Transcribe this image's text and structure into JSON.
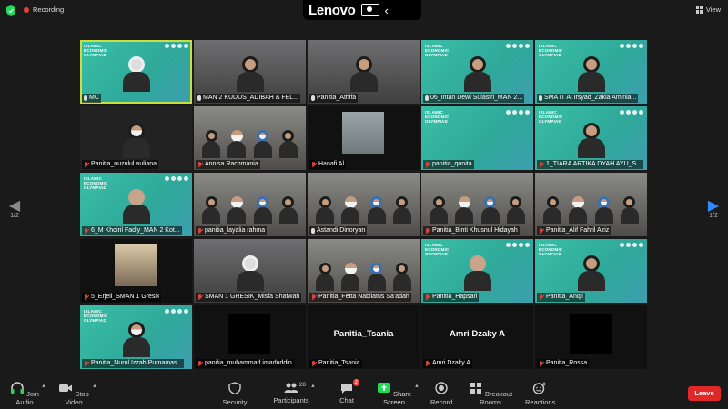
{
  "top": {
    "recording": "Recording",
    "brand": "Lenovo",
    "view": "View"
  },
  "pager": {
    "left": "1/2",
    "right": "1/2"
  },
  "tiles": [
    {
      "name": "MC",
      "muted": false,
      "style": "green-mc",
      "banner": "ISLAMIC\nECONOMIC\nOLYMPIAD"
    },
    {
      "name": "MAN 2 KUDUS_ADIBAH & FEL...",
      "muted": false,
      "style": "room-two"
    },
    {
      "name": "Panitia_Athifa",
      "muted": false,
      "style": "room-two"
    },
    {
      "name": "06_Intan Dewi Sulastri_MAN 2...",
      "muted": false,
      "style": "green-hijab"
    },
    {
      "name": "SMA IT Al Irsyad_Zakia Aminia...",
      "muted": false,
      "style": "green-hijab"
    },
    {
      "name": "Panitia_nuzulul auliana",
      "muted": true,
      "style": "dark-mask"
    },
    {
      "name": "Annisa Rachmania",
      "muted": true,
      "style": "class-crowd"
    },
    {
      "name": "Hanafi Al",
      "muted": true,
      "style": "photo"
    },
    {
      "name": "panitia_qonita",
      "muted": true,
      "style": "green-empty"
    },
    {
      "name": "1_TIARA ARTIKA DYAH AYU_S...",
      "muted": true,
      "style": "green-hijab"
    },
    {
      "name": "6_M Khoiril Fadly_MAN 2 Kot...",
      "muted": true,
      "style": "green-person"
    },
    {
      "name": "panitia_layalia rahma",
      "muted": true,
      "style": "class-crowd"
    },
    {
      "name": "Astandi Dinoryan",
      "muted": false,
      "style": "class-crowd"
    },
    {
      "name": "Panitia_Binti Khusnul Hidayah",
      "muted": true,
      "style": "class-crowd"
    },
    {
      "name": "Panitia_Alif Fahril Aziz",
      "muted": true,
      "style": "class-crowd"
    },
    {
      "name": "5_Erjeli_SMAN 1 Gresik",
      "muted": true,
      "style": "photo-hijab"
    },
    {
      "name": "SMAN 1 GRESIK_Misfa Shafwah",
      "muted": true,
      "style": "room-hijab"
    },
    {
      "name": "Panitia_Fetta Nabilatus Sa'adah",
      "muted": true,
      "style": "class-crowd"
    },
    {
      "name": "Panitia_Hapsari",
      "muted": true,
      "style": "green-person"
    },
    {
      "name": "Panitia_Anqil",
      "muted": true,
      "style": "green-hijab"
    },
    {
      "name": "Panitia_Nurul Izzah Purnamas...",
      "muted": true,
      "style": "green-mask"
    },
    {
      "name": "panitia_muhammad imaduddin",
      "muted": true,
      "style": "black"
    },
    {
      "name": "Panitia_Tsania",
      "muted": true,
      "style": "name",
      "big": "Panitia_Tsania"
    },
    {
      "name": "Amri Dzaky A",
      "muted": true,
      "style": "name",
      "big": "Amri Dzaky A"
    },
    {
      "name": "Panitia_Rossa",
      "muted": true,
      "style": "black"
    }
  ],
  "toolbar": {
    "join_audio": "Join Audio",
    "stop_video": "Stop Video",
    "security": "Security",
    "participants": "Participants",
    "participants_count": "28",
    "chat": "Chat",
    "chat_badge": "2",
    "share_screen": "Share Screen",
    "record": "Record",
    "breakout": "Breakout Rooms",
    "reactions": "Reactions",
    "leave": "Leave"
  },
  "colors": {
    "accent_green": "#39bfa6",
    "share_green": "#23d959",
    "leave_red": "#e02828",
    "active_outline": "#c8e03c",
    "pager_blue": "#2d8cff"
  }
}
